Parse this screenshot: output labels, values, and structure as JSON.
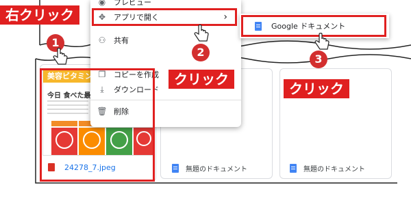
{
  "annotations": {
    "right_click_label": "右クリック",
    "click_label_2": "クリック",
    "click_label_3": "クリック",
    "step1": "1",
    "step2": "2",
    "step3": "3"
  },
  "context_menu": {
    "preview_label": "プレビュー",
    "open_with_label": "アプリで開く",
    "open_with_chevron": "›",
    "share_label": "共有",
    "copy_label": "コピーを作成",
    "download_label": "ダウンロード",
    "delete_label": "削除"
  },
  "submenu": {
    "google_docs_label": "Google ドキュメント"
  },
  "image_file": {
    "name": "24278_7.jpeg",
    "thumb_title": "美容ビタミン",
    "thumb_sub": "今日 食べた最良の方"
  },
  "doc_files": [
    {
      "name": "無題のドキュメント"
    },
    {
      "name": "無題のドキュメント"
    }
  ],
  "colors": {
    "annotation_red": "#e02020",
    "docs_blue": "#4285f4"
  }
}
